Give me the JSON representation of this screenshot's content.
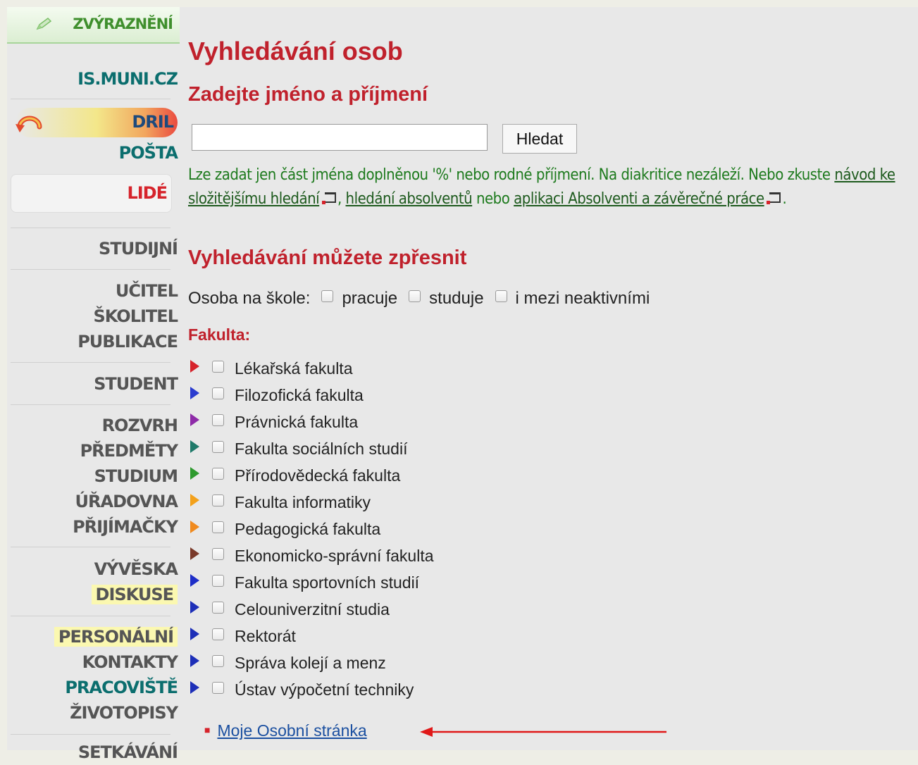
{
  "sidebar": {
    "highlight_label": "ZVÝRAZNĚNÍ",
    "items": {
      "is": "IS.MUNI.CZ",
      "dril": "DRIL",
      "posta": "POŠTA",
      "lide": "LIDÉ",
      "studijni": "STUDIJNÍ",
      "ucitel": "UČITEL",
      "skolitel": "ŠKOLITEL",
      "publikace": "PUBLIKACE",
      "student": "STUDENT",
      "rozvrh": "ROZVRH",
      "predmety": "PŘEDMĚTY",
      "studium": "STUDIUM",
      "uradovna": "ÚŘADOVNA",
      "prijimacky": "PŘIJÍMAČKY",
      "vyveska": "VÝVĚSKA",
      "diskuse": "DISKUSE",
      "personalni": "PERSONÁLNÍ",
      "kontakty": "KONTAKTY",
      "pracoviste": "PRACOVIŠTĚ",
      "zivotopisy": "ŽIVOTOPISY",
      "setkavani": "SETKÁVÁNÍ"
    }
  },
  "main": {
    "title": "Vyhledávání osob",
    "subtitle": "Zadejte jméno a příjmení",
    "search": {
      "value": "",
      "button": "Hledat"
    },
    "hint": {
      "text1": "Lze zadat jen část jména doplněnou '%' nebo rodné příjmení. Na diakritice nezáleží. Nebo zkuste ",
      "link1": "návod ke složitějšímu hledání",
      "text2": ", ",
      "link2": "hledání absolventů",
      "text3": " nebo ",
      "link3": "aplikaci Absolventi a závěrečné práce",
      "text4": "."
    },
    "refine_title": "Vyhledávání můžete zpřesnit",
    "osoba": {
      "label": "Osoba na škole:",
      "options": [
        "pracuje",
        "studuje",
        "i mezi neaktivními"
      ]
    },
    "fakulta_label": "Fakulta:",
    "faculties": [
      {
        "name": "Lékařská fakulta",
        "color": "#d6232b"
      },
      {
        "name": "Filozofická fakulta",
        "color": "#2b3ccf"
      },
      {
        "name": "Právnická fakulta",
        "color": "#8e2ba8"
      },
      {
        "name": "Fakulta sociálních studií",
        "color": "#1f7a6a"
      },
      {
        "name": "Přírodovědecká fakulta",
        "color": "#2e9a2e"
      },
      {
        "name": "Fakulta informatiky",
        "color": "#f3a11b"
      },
      {
        "name": "Pedagogická fakulta",
        "color": "#f08a1e"
      },
      {
        "name": "Ekonomicko-správní fakulta",
        "color": "#7a3a2a"
      },
      {
        "name": "Fakulta sportovních studií",
        "color": "#1e2ec8"
      },
      {
        "name": "Celouniverzitní studia",
        "color": "#1d2fb8"
      },
      {
        "name": "Rektorát",
        "color": "#1d2fb8"
      },
      {
        "name": "Správa kolejí a menz",
        "color": "#1d2fb8"
      },
      {
        "name": "Ústav výpočetní techniky",
        "color": "#1d2fb8"
      }
    ],
    "my_page_link": "Moje Osobní stránka",
    "accent_red": "#c0212c"
  }
}
